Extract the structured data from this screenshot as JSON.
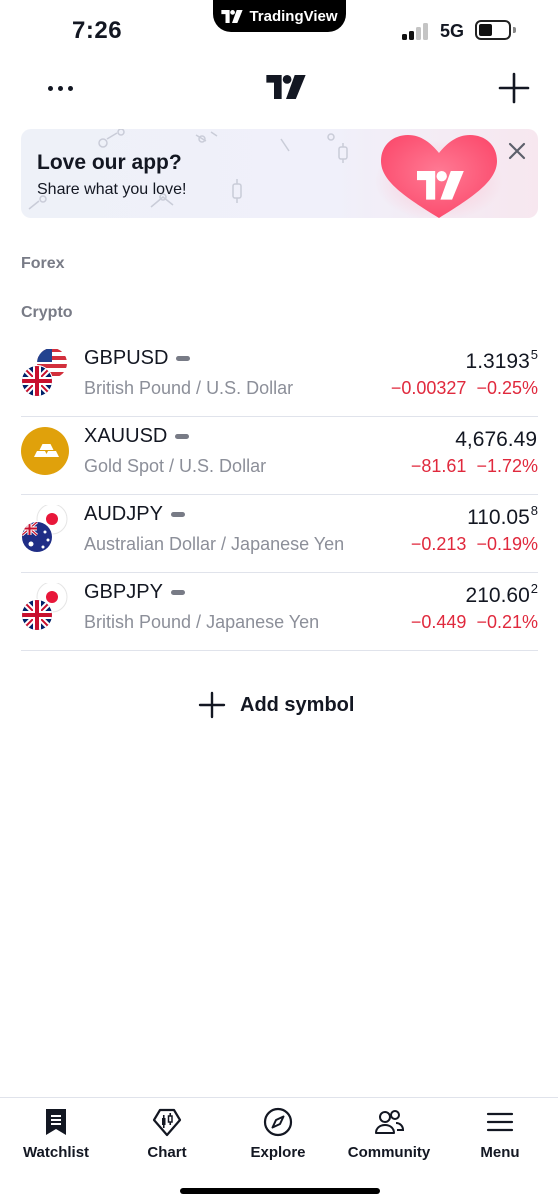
{
  "status_bar": {
    "time": "7:26",
    "island_app": "TradingView",
    "network": "5G"
  },
  "header": {
    "more_icon": "more-horizontal-icon",
    "logo_icon": "tradingview-logo-icon",
    "add_icon": "plus-icon"
  },
  "banner": {
    "title": "Love our app?",
    "subtitle": "Share what you love!",
    "close_icon": "close-icon",
    "heart_icon": "heart-logo-icon"
  },
  "sections": {
    "forex": "Forex",
    "crypto": "Crypto"
  },
  "watchlist": [
    {
      "symbol": "GBPUSD",
      "description": "British Pound / U.S. Dollar",
      "price_main": "1.3193",
      "price_sup": "5",
      "change": "−0.00327",
      "change_pct": "−0.25%",
      "flags": [
        "us",
        "gb"
      ]
    },
    {
      "symbol": "XAUUSD",
      "description": "Gold Spot / U.S. Dollar",
      "price_main": "4,676.49",
      "price_sup": "",
      "change": "−81.61",
      "change_pct": "−1.72%",
      "flags": [
        "gold"
      ]
    },
    {
      "symbol": "AUDJPY",
      "description": "Australian Dollar / Japanese Yen",
      "price_main": "110.05",
      "price_sup": "8",
      "change": "−0.213",
      "change_pct": "−0.19%",
      "flags": [
        "jp",
        "au"
      ]
    },
    {
      "symbol": "GBPJPY",
      "description": "British Pound / Japanese Yen",
      "price_main": "210.60",
      "price_sup": "2",
      "change": "−0.449",
      "change_pct": "−0.21%",
      "flags": [
        "jp",
        "gb"
      ]
    }
  ],
  "add_symbol": {
    "label": "Add symbol",
    "icon": "plus-icon"
  },
  "bottom_nav": [
    {
      "label": "Watchlist",
      "icon": "watchlist-icon",
      "active": true
    },
    {
      "label": "Chart",
      "icon": "chart-icon",
      "active": false
    },
    {
      "label": "Explore",
      "icon": "compass-icon",
      "active": false
    },
    {
      "label": "Community",
      "icon": "community-icon",
      "active": false
    },
    {
      "label": "Menu",
      "icon": "hamburger-icon",
      "active": false
    }
  ],
  "colors": {
    "negative": "#e0293d",
    "text": "#131722",
    "muted": "#8c8f99",
    "divider": "#e0e3eb",
    "gold": "#e0a10b"
  }
}
